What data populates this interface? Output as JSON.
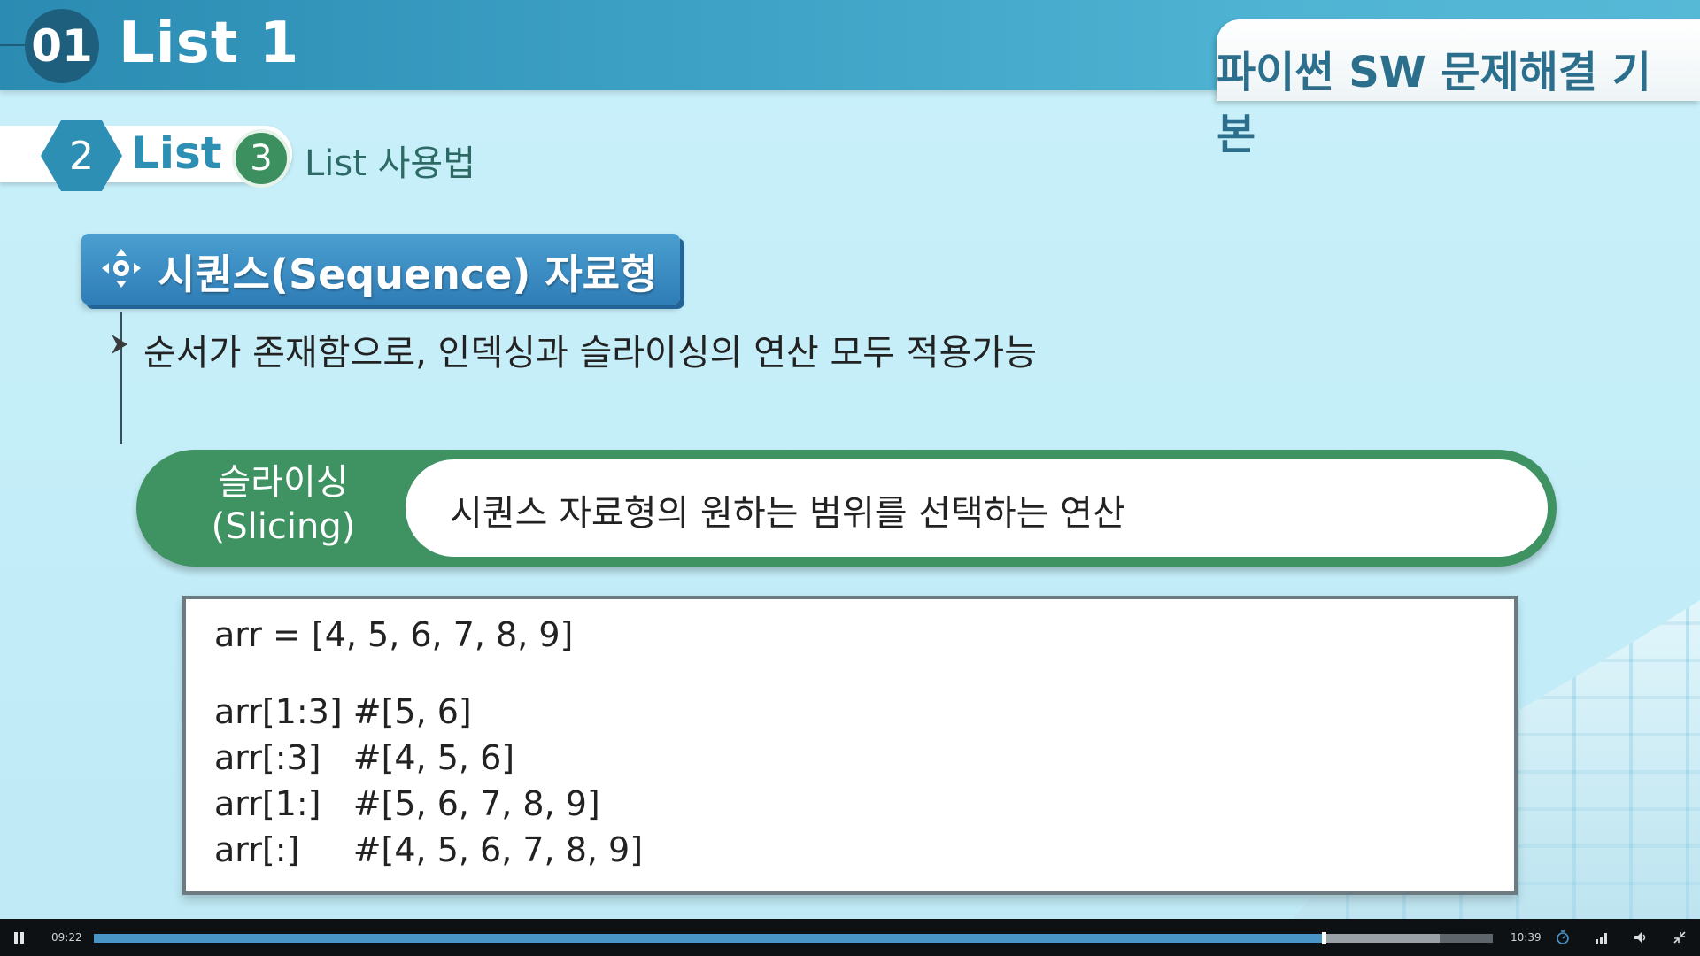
{
  "header": {
    "section_number": "01",
    "section_title": "List 1",
    "course_title": "파이썬 SW 문제해결 기본"
  },
  "breadcrumb": {
    "step_a_number": "2",
    "step_a_label": "List",
    "step_b_number": "3",
    "step_b_label": "List 사용법"
  },
  "content": {
    "heading": "시퀀스(Sequence) 자료형",
    "bullet": "순서가 존재함으로, 인덱싱과 슬라이싱의 연산 모두 적용가능",
    "definition": {
      "term_line1": "슬라이싱",
      "term_line2": "(Slicing)",
      "description": "시퀀스 자료형의 원하는 범위를 선택하는 연산"
    },
    "code_lines": [
      "arr = [4, 5, 6, 7, 8, 9]",
      "arr[1:3] #[5, 6]",
      "arr[:3]   #[4, 5, 6]",
      "arr[1:]   #[5, 6, 7, 8, 9]",
      "arr[:]     #[4, 5, 6, 7, 8, 9]"
    ]
  },
  "player": {
    "current_time": "09:22",
    "total_time": "10:39",
    "progress_fraction": 0.879,
    "buffered_fraction": 0.962,
    "icons": [
      "pause-icon",
      "speed-icon",
      "quality-icon",
      "volume-icon",
      "fullscreen-exit-icon"
    ]
  },
  "colors": {
    "header_blue": "#3fa3c7",
    "section_circle": "#1e5f7e",
    "heading_blue": "#2f7db7",
    "definition_green": "#3f9362",
    "progress_blue": "#4a95c7"
  }
}
